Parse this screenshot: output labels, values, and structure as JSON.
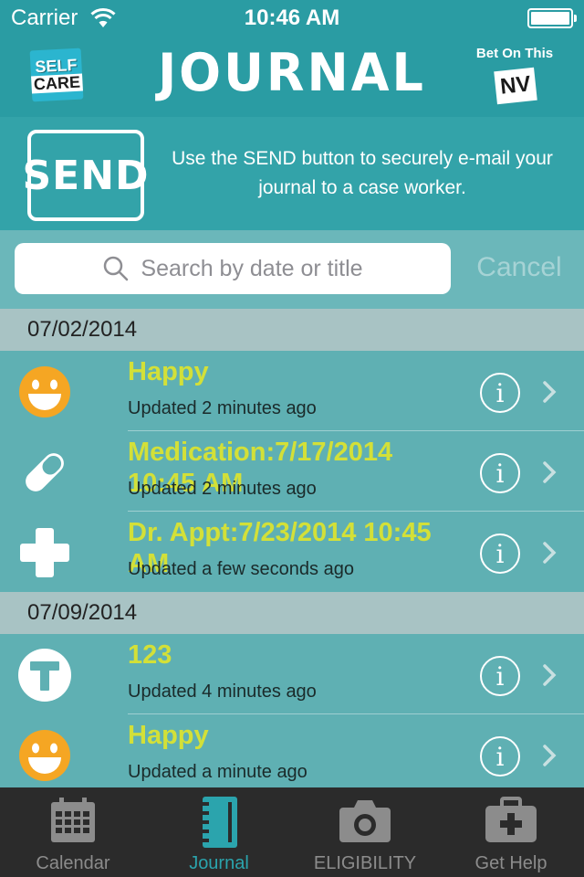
{
  "status_bar": {
    "carrier": "Carrier",
    "time": "10:46 AM"
  },
  "header": {
    "logo_top": "SELF",
    "logo_bottom": "CARE",
    "title": "JOURNAL",
    "partner_label": "Bet On This",
    "partner_badge": "NV"
  },
  "send_banner": {
    "button_label": "SEND",
    "description": "Use the SEND button to securely e-mail your journal to a case worker."
  },
  "search": {
    "placeholder": "Search by date or title",
    "cancel_label": "Cancel"
  },
  "sections": [
    {
      "date": "07/02/2014",
      "entries": [
        {
          "icon": "smiley-icon",
          "title": "Happy",
          "updated": "Updated 2 minutes ago"
        },
        {
          "icon": "pill-icon",
          "title": "Medication:7/17/2014 10:45 AM",
          "updated": "Updated 2 minutes ago"
        },
        {
          "icon": "medical-cross-icon",
          "title": "Dr. Appt:7/23/2014 10:45 AM",
          "updated": "Updated a few seconds ago"
        }
      ]
    },
    {
      "date": "07/09/2014",
      "entries": [
        {
          "icon": "text-t-icon",
          "title": "123",
          "updated": "Updated 4 minutes ago"
        },
        {
          "icon": "smiley-icon",
          "title": "Happy",
          "updated": "Updated a minute ago"
        }
      ]
    }
  ],
  "tab_bar": {
    "active": "Journal",
    "tabs": [
      {
        "label": "Calendar",
        "icon": "calendar-icon"
      },
      {
        "label": "Journal",
        "icon": "notebook-icon"
      },
      {
        "label": "ELIGIBILITY",
        "icon": "camera-icon"
      },
      {
        "label": "Get Help",
        "icon": "first-aid-kit-icon"
      }
    ]
  },
  "colors": {
    "header_bg": "#2a9ca3",
    "row_bg": "#5fb0b3",
    "section_bg": "#a8c3c4",
    "title_yellow": "#d3e038",
    "smiley_orange": "#f5a623",
    "tab_active": "#2ba4ad",
    "tab_bar_bg": "#2b2b2b"
  }
}
